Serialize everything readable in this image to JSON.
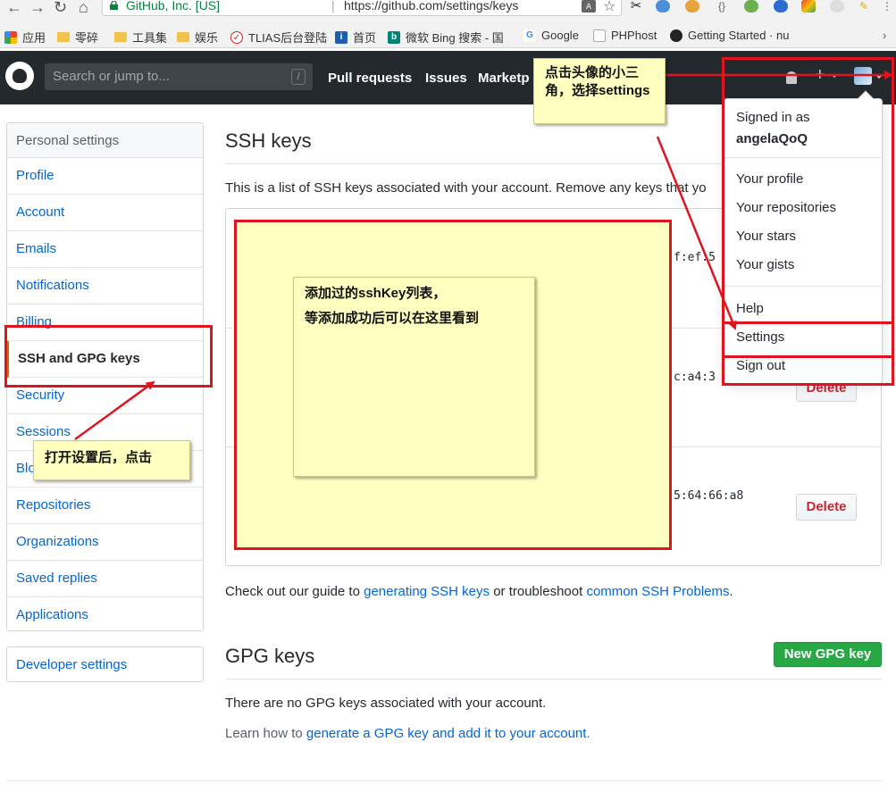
{
  "browser": {
    "site_name": "GitHub, Inc. [US]",
    "url": "https://github.com/settings/keys"
  },
  "bookmarks": [
    {
      "label": "应用",
      "icon": "apps-grid-icon"
    },
    {
      "label": "零碎",
      "icon": "folder-icon"
    },
    {
      "label": "工具集",
      "icon": "folder-icon"
    },
    {
      "label": "娱乐",
      "icon": "folder-icon"
    },
    {
      "label": "TLIAS后台登陆",
      "icon": "tlias-icon"
    },
    {
      "label": "首页",
      "icon": "info-icon"
    },
    {
      "label": "微软 Bing 搜索 - 国内",
      "icon": "bing-icon"
    },
    {
      "label": "Google",
      "icon": "google-icon"
    },
    {
      "label": "PHPhost",
      "icon": "page-icon"
    },
    {
      "label": "Getting Started · nu",
      "icon": "github-icon"
    }
  ],
  "header": {
    "search_placeholder": "Search or jump to...",
    "slash_key": "/",
    "nav": [
      "Pull requests",
      "Issues",
      "Marketp"
    ]
  },
  "sidebar": {
    "heading": "Personal settings",
    "items": [
      {
        "label": "Profile"
      },
      {
        "label": "Account"
      },
      {
        "label": "Emails"
      },
      {
        "label": "Notifications"
      },
      {
        "label": "Billing"
      },
      {
        "label": "SSH and GPG keys",
        "selected": true
      },
      {
        "label": "Security"
      },
      {
        "label": "Sessions"
      },
      {
        "label": "Blo"
      },
      {
        "label": "Repositories"
      },
      {
        "label": "Organizations"
      },
      {
        "label": "Saved replies"
      },
      {
        "label": "Applications"
      }
    ],
    "developer_settings": "Developer settings"
  },
  "ssh": {
    "title": "SSH keys",
    "description": "This is a list of SSH keys associated with your account. Remove any keys that yo",
    "fingerprints": [
      "f:ef:5",
      "c:a4:3",
      "5:64:66:a8"
    ],
    "delete_label": "Delete",
    "guide_prefix": "Check out our guide to ",
    "guide_link1": "generating SSH keys",
    "guide_middle": " or troubleshoot ",
    "guide_link2": "common SSH Problems",
    "guide_suffix": "."
  },
  "gpg": {
    "title": "GPG keys",
    "new_button": "New GPG key",
    "none_text": "There are no GPG keys associated with your account.",
    "learn_prefix": "Learn how to ",
    "learn_link": "generate a GPG key and add it to your account",
    "learn_suffix": "."
  },
  "dropdown": {
    "signed_in_as": "Signed in as",
    "username": "angelaQoQ",
    "group1": [
      "Your profile",
      "Your repositories",
      "Your stars",
      "Your gists"
    ],
    "group2": [
      "Help",
      "Settings",
      "Sign out"
    ]
  },
  "annotations": {
    "avatar_note": "点击头像的小三角，选择settings",
    "list_note_line1": "添加过的sshKey列表，",
    "list_note_line2": "等添加成功后可以在这里看到",
    "sidebar_note": "打开设置后，点击"
  },
  "colors": {
    "link": "#0366d6",
    "header_bg": "#24292e",
    "annotation_red": "#e0141e",
    "note_yellow": "#ffffc0",
    "green_button": "#28a745",
    "delete_red": "#cb2431"
  }
}
